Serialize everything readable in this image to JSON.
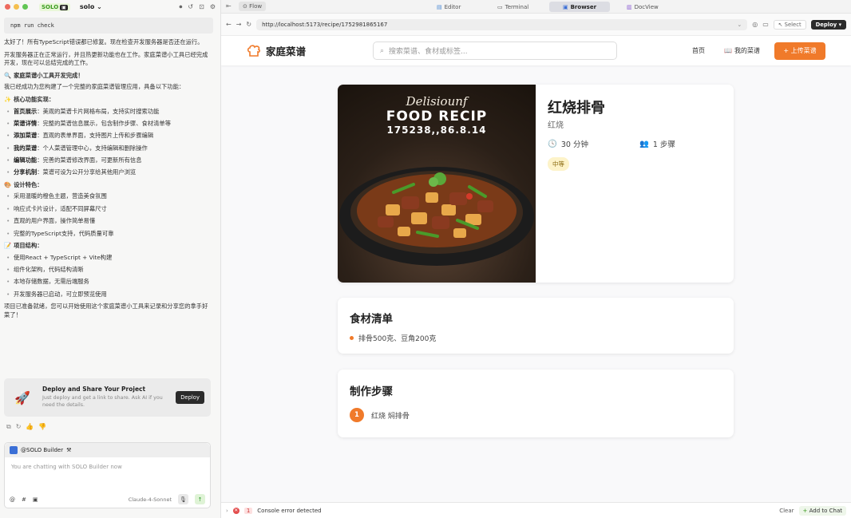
{
  "left": {
    "app_name": "SOLO",
    "workspace": "solo",
    "code": "npm run check",
    "p1": "太好了！所有TypeScript错误都已修复。现在检查开发服务器是否还在运行。",
    "p2": "开发服务器正在正常运行，并且热更新功能也在工作。家庭菜谱小工具已经完成开发，现在可以总结完成的工作。",
    "h_done": "家庭菜谱小工具开发完成！",
    "p3": "我已经成功为您构建了一个完整的家庭菜谱管理应用，具备以下功能：",
    "h_core": "核心功能实现：",
    "core": [
      {
        "b": "首页展示",
        "t": "：美观的菜谱卡片网格布局，支持实时搜索功能"
      },
      {
        "b": "菜谱详情",
        "t": "：完整的菜谱信息展示，包含制作步骤、食材清单等"
      },
      {
        "b": "添加菜谱",
        "t": "：直观的表单界面，支持图片上传和步骤编辑"
      },
      {
        "b": "我的菜谱",
        "t": "：个人菜谱管理中心，支持编辑和删除操作"
      },
      {
        "b": "编辑功能",
        "t": "：完善的菜谱修改界面，可更新所有信息"
      },
      {
        "b": "分享机制",
        "t": "：菜谱可设为公开分享给其他用户浏览"
      }
    ],
    "h_design": "设计特色：",
    "design": [
      "采用温暖的橙色主题，营造美食氛围",
      "响应式卡片设计，适配不同屏幕尺寸",
      "直观的用户界面，操作简单易懂",
      "完整的TypeScript支持，代码质量可靠"
    ],
    "h_struct": "项目结构：",
    "struct": [
      "使用React + TypeScript + Vite构建",
      "组件化架构，代码结构清晰",
      "本地存储数据，无需后端服务",
      "开发服务器已启动，可立即预览使用"
    ],
    "p4": "项目已准备就绪，您可以开始使用这个家庭菜谱小工具来记录和分享您的拿手好菜了！",
    "deploy_title": "Deploy and Share Your Project",
    "deploy_sub": "Just deploy and get a link to share. Ask AI if you need the details.",
    "deploy_btn": "Deploy",
    "agent": "@SOLO Builder",
    "input_placeholder": "You are chatting with SOLO Builder now",
    "model": "Claude-4-Sonnet"
  },
  "tabs": {
    "flow": "Flow",
    "editor": "Editor",
    "terminal": "Terminal",
    "browser": "Browser",
    "docview": "DocView"
  },
  "browser": {
    "url": "http://localhost:5173/recipe/1752981865167",
    "select": "Select",
    "deploy": "Deploy"
  },
  "site": {
    "brand": "家庭菜谱",
    "search_placeholder": "搜索菜谱、食材或标签...",
    "nav_home": "首页",
    "nav_mine": "我的菜谱",
    "upload": "+ 上传菜谱",
    "photo_line1": "Delisiounf",
    "photo_line2": "FOOD RECIP",
    "photo_line3": "175238,,86.8.14",
    "recipe_title": "红烧排骨",
    "recipe_category": "红烧",
    "time": "30 分钟",
    "steps_count": "1 步骤",
    "difficulty": "中等",
    "ingredients_title": "食材清单",
    "ingredients": [
      "排骨500克、豆角200克"
    ],
    "steps_title": "制作步骤",
    "steps": [
      {
        "n": "1",
        "text": "红烧 焖排骨"
      }
    ]
  },
  "console": {
    "count": "1",
    "text": "Console error detected",
    "clear": "Clear",
    "add": "Add to Chat"
  }
}
